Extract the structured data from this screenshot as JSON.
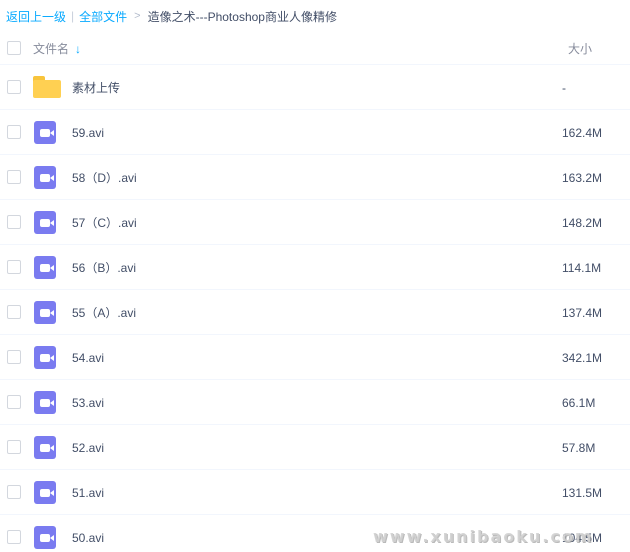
{
  "breadcrumb": {
    "back": "返回上一级",
    "sep": "|",
    "all_files": "全部文件",
    "arrow": ">",
    "current": "造像之术---Photoshop商业人像精修"
  },
  "header": {
    "name_label": "文件名",
    "sort_icon": "arrow-down-icon",
    "size_label": "大小"
  },
  "files": [
    {
      "name": "素材上传",
      "size": "-",
      "type": "folder"
    },
    {
      "name": "59.avi",
      "size": "162.4M",
      "type": "video"
    },
    {
      "name": "58（D）.avi",
      "size": "163.2M",
      "type": "video"
    },
    {
      "name": "57（C）.avi",
      "size": "148.2M",
      "type": "video"
    },
    {
      "name": "56（B）.avi",
      "size": "114.1M",
      "type": "video"
    },
    {
      "name": "55（A）.avi",
      "size": "137.4M",
      "type": "video"
    },
    {
      "name": "54.avi",
      "size": "342.1M",
      "type": "video"
    },
    {
      "name": "53.avi",
      "size": "66.1M",
      "type": "video"
    },
    {
      "name": "52.avi",
      "size": "57.8M",
      "type": "video"
    },
    {
      "name": "51.avi",
      "size": "131.5M",
      "type": "video"
    },
    {
      "name": "50.avi",
      "size": "104.5M",
      "type": "video"
    }
  ],
  "watermark": "www.xunibaoku.com",
  "colors": {
    "link": "#09aaff",
    "video_icon": "#7a7bf0",
    "folder_icon": "#ffd052"
  }
}
